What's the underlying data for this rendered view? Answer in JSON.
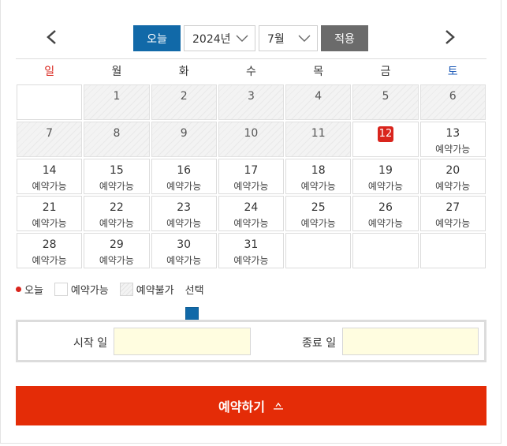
{
  "nav": {
    "today_label": "오늘",
    "year_value": "2024년",
    "month_value": "7월",
    "apply_label": "적용"
  },
  "weekdays": [
    "일",
    "월",
    "화",
    "수",
    "목",
    "금",
    "토"
  ],
  "days": [
    {
      "num": "",
      "status": "",
      "type": "empty"
    },
    {
      "num": "1",
      "status": "",
      "type": "blocked"
    },
    {
      "num": "2",
      "status": "",
      "type": "blocked"
    },
    {
      "num": "3",
      "status": "",
      "type": "blocked"
    },
    {
      "num": "4",
      "status": "",
      "type": "blocked"
    },
    {
      "num": "5",
      "status": "",
      "type": "blocked"
    },
    {
      "num": "6",
      "status": "",
      "type": "blocked"
    },
    {
      "num": "7",
      "status": "",
      "type": "blocked"
    },
    {
      "num": "8",
      "status": "",
      "type": "blocked"
    },
    {
      "num": "9",
      "status": "",
      "type": "blocked"
    },
    {
      "num": "10",
      "status": "",
      "type": "blocked"
    },
    {
      "num": "11",
      "status": "",
      "type": "blocked"
    },
    {
      "num": "12",
      "status": "",
      "type": "today"
    },
    {
      "num": "13",
      "status": "예약가능",
      "type": "available"
    },
    {
      "num": "14",
      "status": "예약가능",
      "type": "available"
    },
    {
      "num": "15",
      "status": "예약가능",
      "type": "available"
    },
    {
      "num": "16",
      "status": "예약가능",
      "type": "available"
    },
    {
      "num": "17",
      "status": "예약가능",
      "type": "available"
    },
    {
      "num": "18",
      "status": "예약가능",
      "type": "available"
    },
    {
      "num": "19",
      "status": "예약가능",
      "type": "available"
    },
    {
      "num": "20",
      "status": "예약가능",
      "type": "available"
    },
    {
      "num": "21",
      "status": "예약가능",
      "type": "available"
    },
    {
      "num": "22",
      "status": "예약가능",
      "type": "available"
    },
    {
      "num": "23",
      "status": "예약가능",
      "type": "available"
    },
    {
      "num": "24",
      "status": "예약가능",
      "type": "available"
    },
    {
      "num": "25",
      "status": "예약가능",
      "type": "available"
    },
    {
      "num": "26",
      "status": "예약가능",
      "type": "available"
    },
    {
      "num": "27",
      "status": "예약가능",
      "type": "available"
    },
    {
      "num": "28",
      "status": "예약가능",
      "type": "available"
    },
    {
      "num": "29",
      "status": "예약가능",
      "type": "available"
    },
    {
      "num": "30",
      "status": "예약가능",
      "type": "available"
    },
    {
      "num": "31",
      "status": "예약가능",
      "type": "available"
    },
    {
      "num": "",
      "status": "",
      "type": "empty"
    },
    {
      "num": "",
      "status": "",
      "type": "empty"
    },
    {
      "num": "",
      "status": "",
      "type": "empty"
    }
  ],
  "legend": {
    "today": "오늘",
    "available": "예약가능",
    "unavailable": "예약불가",
    "selected": "선택"
  },
  "date_range": {
    "start_label": "시작 일",
    "start_value": "",
    "end_label": "종료 일",
    "end_value": ""
  },
  "reserve_label": "예약하기",
  "colors": {
    "primary": "#1169a8",
    "accent": "#e42c07",
    "today": "#d9251d",
    "sunday": "#d9251d",
    "saturday": "#1e5bb8",
    "apply": "#6b6b6b",
    "input_bg": "#fffde0"
  }
}
